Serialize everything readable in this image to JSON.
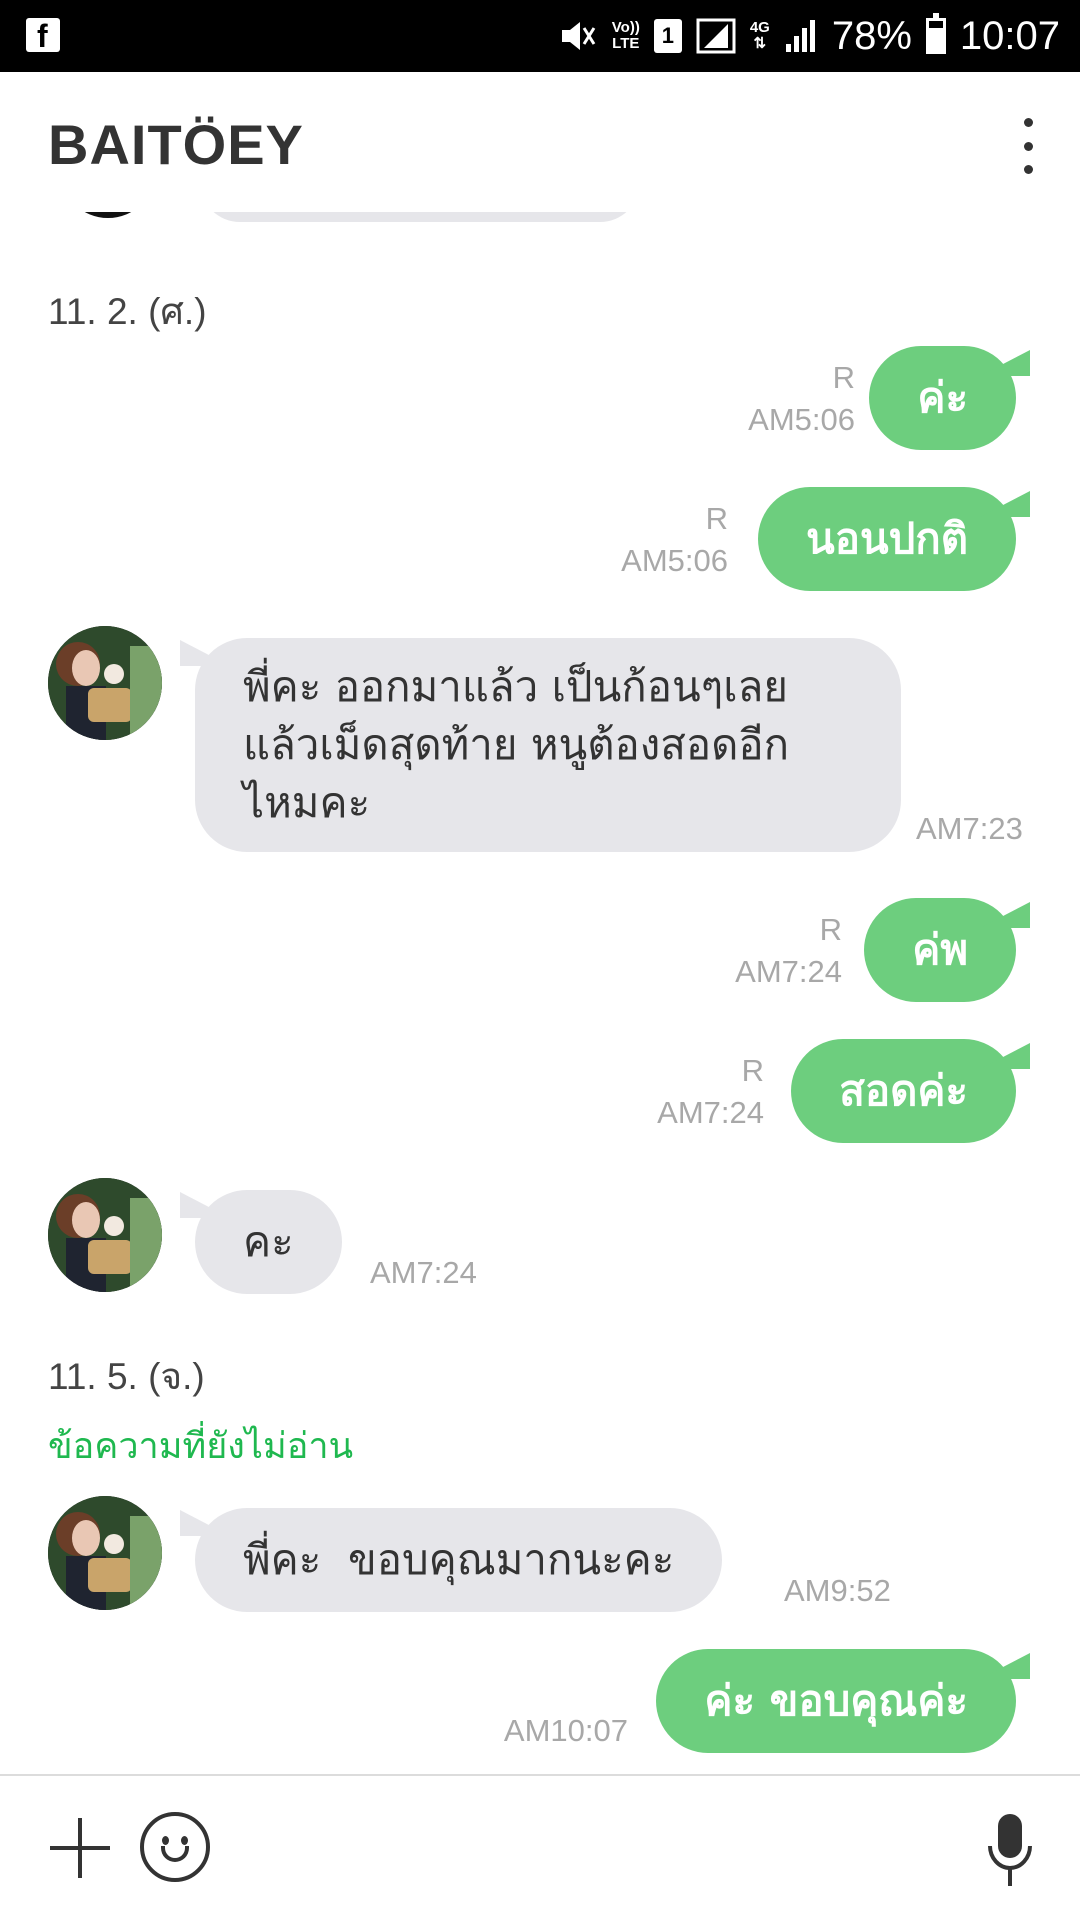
{
  "status_bar": {
    "left_icon": "facebook-icon",
    "signal_labels": {
      "volte_top": "Vo))",
      "volte_bottom": "LTE",
      "sim": "1",
      "net_top": "4G",
      "net_bottom": "⇅"
    },
    "battery": "78%",
    "battery_level": 0.78,
    "time": "10:07"
  },
  "header": {
    "title": "BAITÖEY",
    "menu_icon": "more-vertical-icon"
  },
  "chat": {
    "date_1": "11. 2. (ศ.)",
    "msg_1": {
      "text": "ค่ะ",
      "read": "R",
      "time": "AM5:06"
    },
    "msg_2": {
      "text": "นอนปกติ",
      "read": "R",
      "time": "AM5:06"
    },
    "msg_3": {
      "lines": [
        "พี่คะ ออกมาแล้ว เป็นก้อนๆเลย",
        "แล้วเม็ดสุดท้าย หนูต้องสอดอีก",
        "ไหมคะ"
      ],
      "time": "AM7:23"
    },
    "msg_4": {
      "text": "ค่พ",
      "read": "R",
      "time": "AM7:24"
    },
    "msg_5": {
      "text": "สอดค่ะ",
      "read": "R",
      "time": "AM7:24"
    },
    "msg_6": {
      "text": "คะ",
      "time": "AM7:24"
    },
    "date_2": "11. 5. (จ.)",
    "unread_label": "ข้อความที่ยังไม่อ่าน",
    "msg_7": {
      "text": "พี่คะ  ขอบคุณมากนะคะ",
      "time": "AM9:52"
    },
    "msg_8": {
      "text": "ค่ะ ขอบคุณค่ะ",
      "time": "AM10:07"
    }
  },
  "input_bar": {
    "add_icon": "plus-icon",
    "sticker_icon": "smiley-icon",
    "voice_icon": "microphone-icon"
  },
  "colors": {
    "outgoing": "#6dce7e",
    "incoming": "#e6e6ea",
    "unread": "#1fb84f",
    "meta": "#a8a8a8"
  }
}
